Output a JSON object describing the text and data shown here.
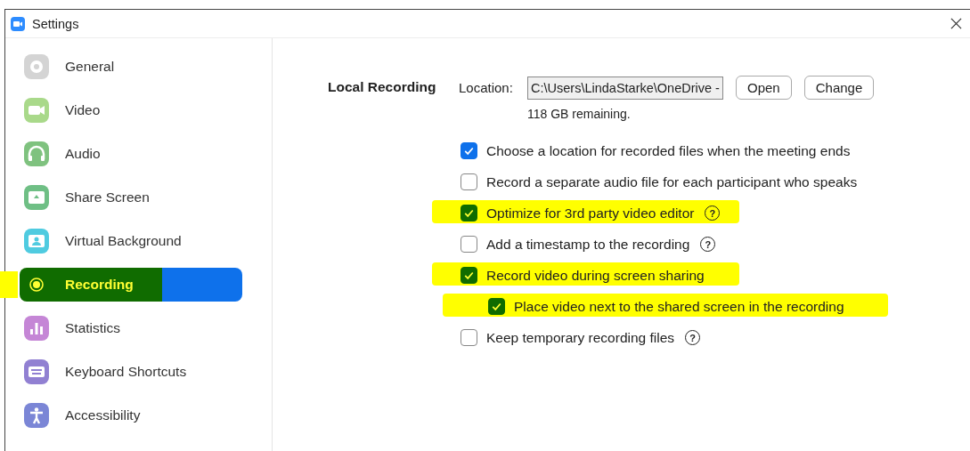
{
  "window": {
    "title": "Settings"
  },
  "sidebar": {
    "items": [
      {
        "label": "General",
        "selected": false,
        "highlighted": false
      },
      {
        "label": "Video",
        "selected": false,
        "highlighted": false
      },
      {
        "label": "Audio",
        "selected": false,
        "highlighted": false
      },
      {
        "label": "Share Screen",
        "selected": false,
        "highlighted": false
      },
      {
        "label": "Virtual Background",
        "selected": false,
        "highlighted": false
      },
      {
        "label": "Recording",
        "selected": true,
        "highlighted": true
      },
      {
        "label": "Statistics",
        "selected": false,
        "highlighted": false
      },
      {
        "label": "Keyboard Shortcuts",
        "selected": false,
        "highlighted": false
      },
      {
        "label": "Accessibility",
        "selected": false,
        "highlighted": false
      }
    ]
  },
  "local_recording": {
    "heading": "Local Recording",
    "location_label": "Location:",
    "location_value": "C:\\Users\\LindaStarke\\OneDrive -",
    "buttons": [
      "Open",
      "Change"
    ],
    "remaining": "118 GB remaining.",
    "options": [
      {
        "label": "Choose a location for recorded files when the meeting ends",
        "checked": true,
        "highlighted": false
      },
      {
        "label": "Record a separate audio file for each participant who speaks",
        "checked": false,
        "highlighted": false
      },
      {
        "label": "Optimize for 3rd party video editor",
        "checked": true,
        "highlighted": true,
        "help": "?"
      },
      {
        "label": "Add a timestamp to the recording",
        "checked": false,
        "highlighted": false,
        "help": "?"
      },
      {
        "label": "Record video during screen sharing",
        "checked": true,
        "highlighted": true,
        "children": [
          {
            "label": "Place video next to the shared screen in the recording",
            "checked": true,
            "highlighted": true
          }
        ]
      },
      {
        "label": "Keep temporary recording files",
        "checked": false,
        "highlighted": false,
        "help": "?"
      }
    ]
  }
}
